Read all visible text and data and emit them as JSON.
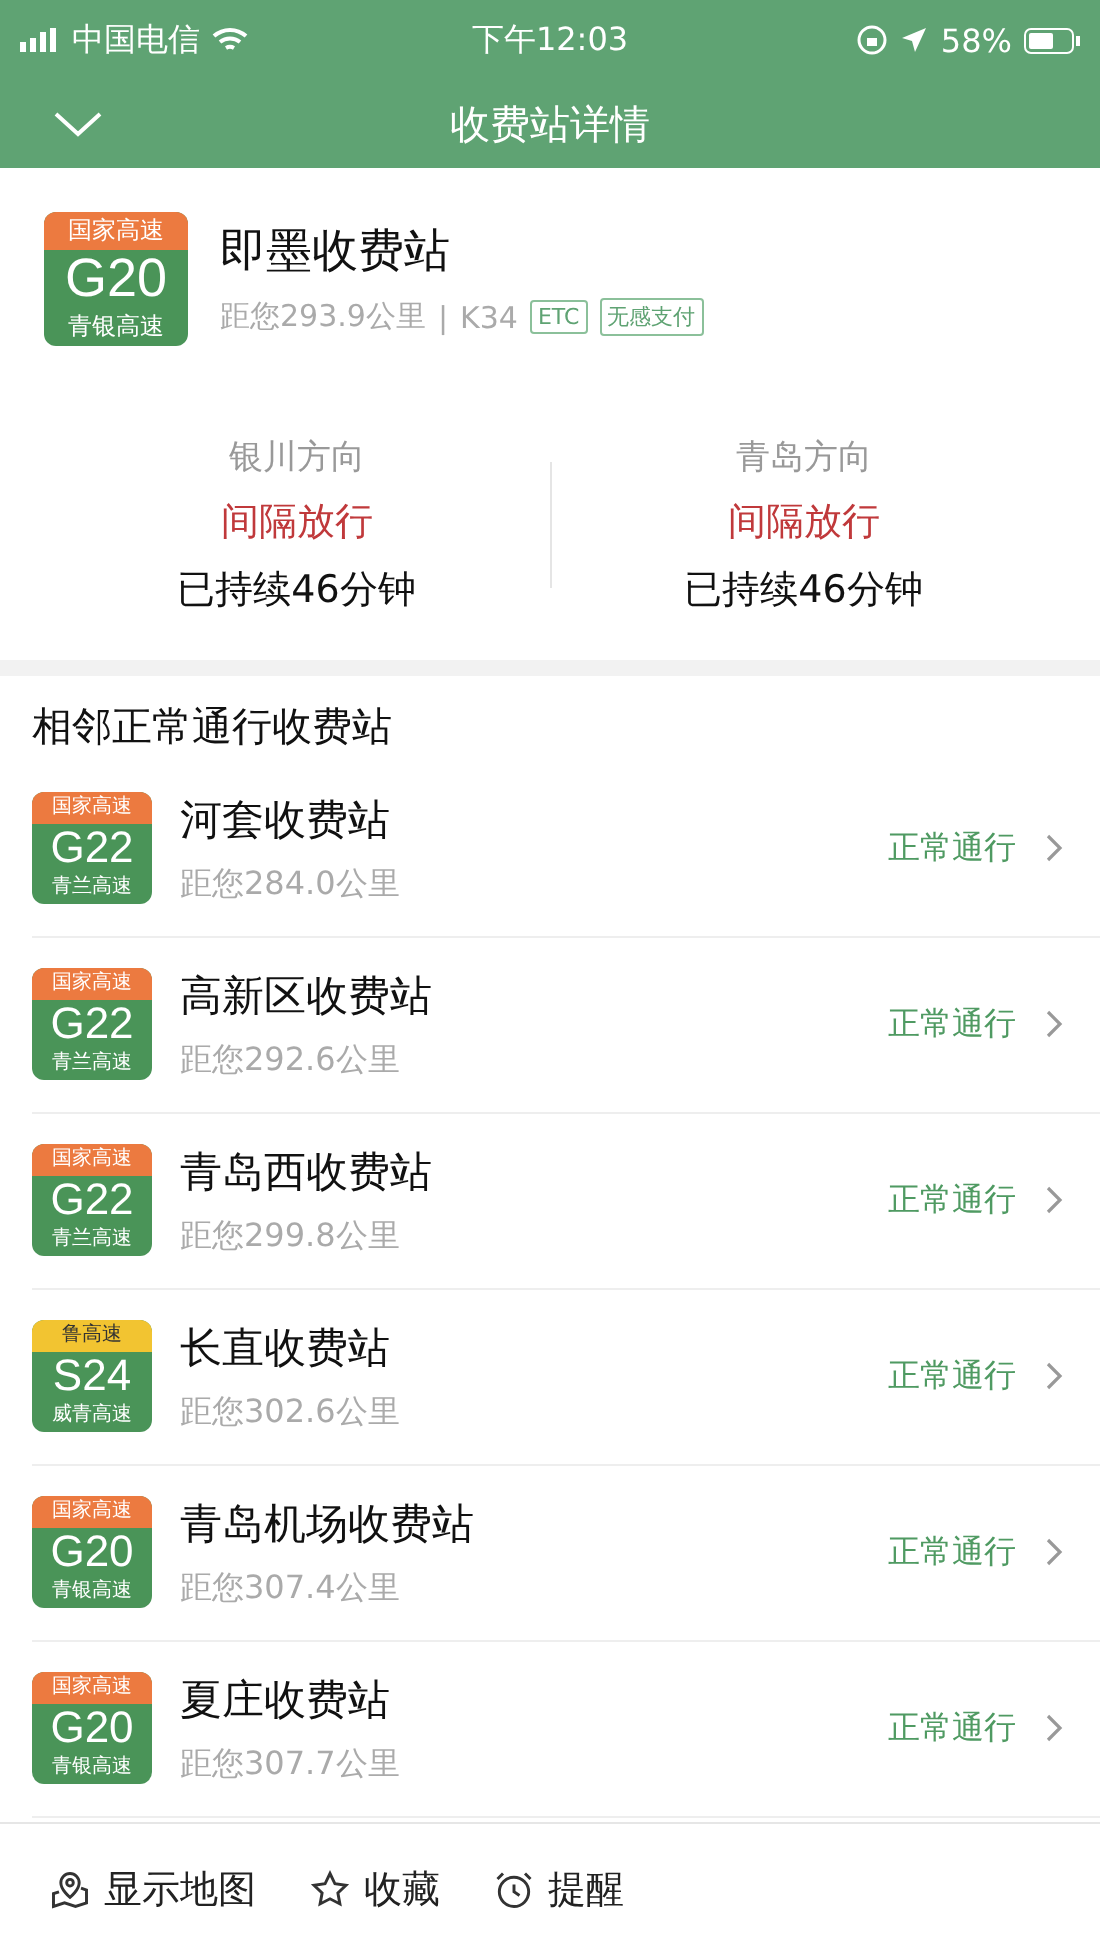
{
  "status_bar": {
    "carrier": "中国电信",
    "time": "下午12:03",
    "battery": "58%"
  },
  "nav": {
    "title": "收费站详情"
  },
  "station": {
    "badge": {
      "kind": "national",
      "network": "国家高速",
      "code": "G20",
      "name": "青银高速"
    },
    "name": "即墨收费站",
    "distance": "距您293.9公里",
    "separator": "|",
    "km": "K34",
    "tags": [
      "ETC",
      "无感支付"
    ],
    "directions": [
      {
        "name": "银川方向",
        "status": "间隔放行",
        "duration": "已持续46分钟"
      },
      {
        "name": "青岛方向",
        "status": "间隔放行",
        "duration": "已持续46分钟"
      }
    ]
  },
  "nearby": {
    "title": "相邻正常通行收费站",
    "items": [
      {
        "badge": {
          "kind": "national",
          "network": "国家高速",
          "code": "G22",
          "name": "青兰高速"
        },
        "name": "河套收费站",
        "distance": "距您284.0公里",
        "status": "正常通行"
      },
      {
        "badge": {
          "kind": "national",
          "network": "国家高速",
          "code": "G22",
          "name": "青兰高速"
        },
        "name": "高新区收费站",
        "distance": "距您292.6公里",
        "status": "正常通行"
      },
      {
        "badge": {
          "kind": "national",
          "network": "国家高速",
          "code": "G22",
          "name": "青兰高速"
        },
        "name": "青岛西收费站",
        "distance": "距您299.8公里",
        "status": "正常通行"
      },
      {
        "badge": {
          "kind": "provincial",
          "network": "鲁高速",
          "code": "S24",
          "name": "威青高速"
        },
        "name": "长直收费站",
        "distance": "距您302.6公里",
        "status": "正常通行"
      },
      {
        "badge": {
          "kind": "national",
          "network": "国家高速",
          "code": "G20",
          "name": "青银高速"
        },
        "name": "青岛机场收费站",
        "distance": "距您307.4公里",
        "status": "正常通行"
      },
      {
        "badge": {
          "kind": "national",
          "network": "国家高速",
          "code": "G20",
          "name": "青银高速"
        },
        "name": "夏庄收费站",
        "distance": "距您307.7公里",
        "status": "正常通行"
      }
    ]
  },
  "toolbar": [
    {
      "kind": "map",
      "label": "显示地图"
    },
    {
      "kind": "favorite",
      "label": "收藏"
    },
    {
      "kind": "alarm",
      "label": "提醒"
    }
  ]
}
